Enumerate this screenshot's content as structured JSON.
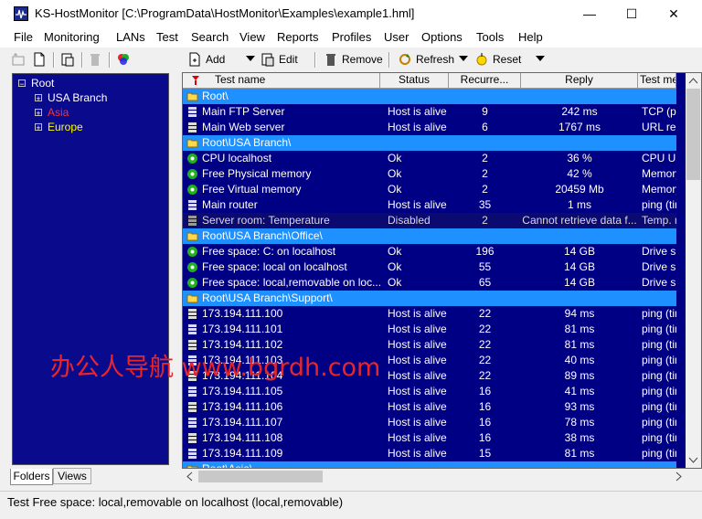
{
  "window": {
    "title": "KS-HostMonitor  [C:\\ProgramData\\HostMonitor\\Examples\\example1.hml]",
    "minimize": "—",
    "maximize": "☐",
    "close": "✕"
  },
  "menu": [
    "File",
    "Monitoring",
    "LANs",
    "Test",
    "Search",
    "View",
    "Reports",
    "Profiles",
    "User",
    "Options",
    "Tools",
    "Help"
  ],
  "toolbar": {
    "add": "Add",
    "edit": "Edit",
    "remove": "Remove",
    "refresh": "Refresh",
    "reset": "Reset"
  },
  "tree": {
    "root": "Root",
    "items": [
      {
        "label": "USA Branch",
        "color": "#ffffff"
      },
      {
        "label": "Asia",
        "color": "#ff3030"
      },
      {
        "label": "Europe",
        "color": "#ffff00"
      }
    ]
  },
  "tabs": {
    "folders": "Folders",
    "views": "Views"
  },
  "columns": [
    "Test name",
    "Status",
    "Recurre...",
    "Reply",
    "Test me"
  ],
  "rows": [
    {
      "kind": "folder",
      "name": "Root\\"
    },
    {
      "kind": "host",
      "name": "Main FTP Server",
      "status": "Host is alive",
      "rec": "9",
      "reply": "242 ms",
      "method": "TCP (port)"
    },
    {
      "kind": "host",
      "name": "Main Web server",
      "status": "Host is alive",
      "rec": "6",
      "reply": "1767 ms",
      "method": "URL request"
    },
    {
      "kind": "folder",
      "name": "Root\\USA Branch\\"
    },
    {
      "kind": "ok",
      "name": "CPU localhost",
      "status": "Ok",
      "rec": "2",
      "reply": "36 %",
      "method": "CPU Usage"
    },
    {
      "kind": "ok",
      "name": "Free Physical memory",
      "status": "Ok",
      "rec": "2",
      "reply": "42 %",
      "method": "Memory"
    },
    {
      "kind": "ok",
      "name": "Free Virtual memory",
      "status": "Ok",
      "rec": "2",
      "reply": "20459 Mb",
      "method": "Memory"
    },
    {
      "kind": "host",
      "name": "Main router",
      "status": "Host is alive",
      "rec": "35",
      "reply": "1 ms",
      "method": "ping (timing)"
    },
    {
      "kind": "disabled",
      "name": "Server room: Temperature",
      "status": "Disabled",
      "rec": "2",
      "reply": "Cannot retrieve data f...",
      "method": "Temp. monitor"
    },
    {
      "kind": "folder",
      "name": "Root\\USA Branch\\Office\\"
    },
    {
      "kind": "ok",
      "name": "Free space: C: on localhost",
      "status": "Ok",
      "rec": "196",
      "reply": "14 GB",
      "method": "Drive space"
    },
    {
      "kind": "ok",
      "name": "Free space: local on localhost",
      "status": "Ok",
      "rec": "55",
      "reply": "14 GB",
      "method": "Drive space"
    },
    {
      "kind": "ok",
      "name": "Free space: local,removable on loc...",
      "status": "Ok",
      "rec": "65",
      "reply": "14 GB",
      "method": "Drive space"
    },
    {
      "kind": "folder",
      "name": "Root\\USA Branch\\Support\\"
    },
    {
      "kind": "host",
      "name": "173.194.111.100",
      "status": "Host is alive",
      "rec": "22",
      "reply": "94 ms",
      "method": "ping (timing)"
    },
    {
      "kind": "host",
      "name": "173.194.111.101",
      "status": "Host is alive",
      "rec": "22",
      "reply": "81 ms",
      "method": "ping (timing)"
    },
    {
      "kind": "host",
      "name": "173.194.111.102",
      "status": "Host is alive",
      "rec": "22",
      "reply": "81 ms",
      "method": "ping (timing)"
    },
    {
      "kind": "host",
      "name": "173.194.111.103",
      "status": "Host is alive",
      "rec": "22",
      "reply": "40 ms",
      "method": "ping (timing)"
    },
    {
      "kind": "host",
      "name": "173.194.111.104",
      "status": "Host is alive",
      "rec": "22",
      "reply": "89 ms",
      "method": "ping (timing)"
    },
    {
      "kind": "host",
      "name": "173.194.111.105",
      "status": "Host is alive",
      "rec": "16",
      "reply": "41 ms",
      "method": "ping (timing)"
    },
    {
      "kind": "host",
      "name": "173.194.111.106",
      "status": "Host is alive",
      "rec": "16",
      "reply": "93 ms",
      "method": "ping (timing)"
    },
    {
      "kind": "host",
      "name": "173.194.111.107",
      "status": "Host is alive",
      "rec": "16",
      "reply": "78 ms",
      "method": "ping (timing)"
    },
    {
      "kind": "host",
      "name": "173.194.111.108",
      "status": "Host is alive",
      "rec": "16",
      "reply": "38 ms",
      "method": "ping (timing)"
    },
    {
      "kind": "host",
      "name": "173.194.111.109",
      "status": "Host is alive",
      "rec": "15",
      "reply": "81 ms",
      "method": "ping (timing)"
    },
    {
      "kind": "folder",
      "name": "Root\\Asia\\"
    }
  ],
  "statusbar": "Test Free space: local,removable on localhost (local,removable)",
  "watermark": "办公人导航 www.bgrdh.com"
}
